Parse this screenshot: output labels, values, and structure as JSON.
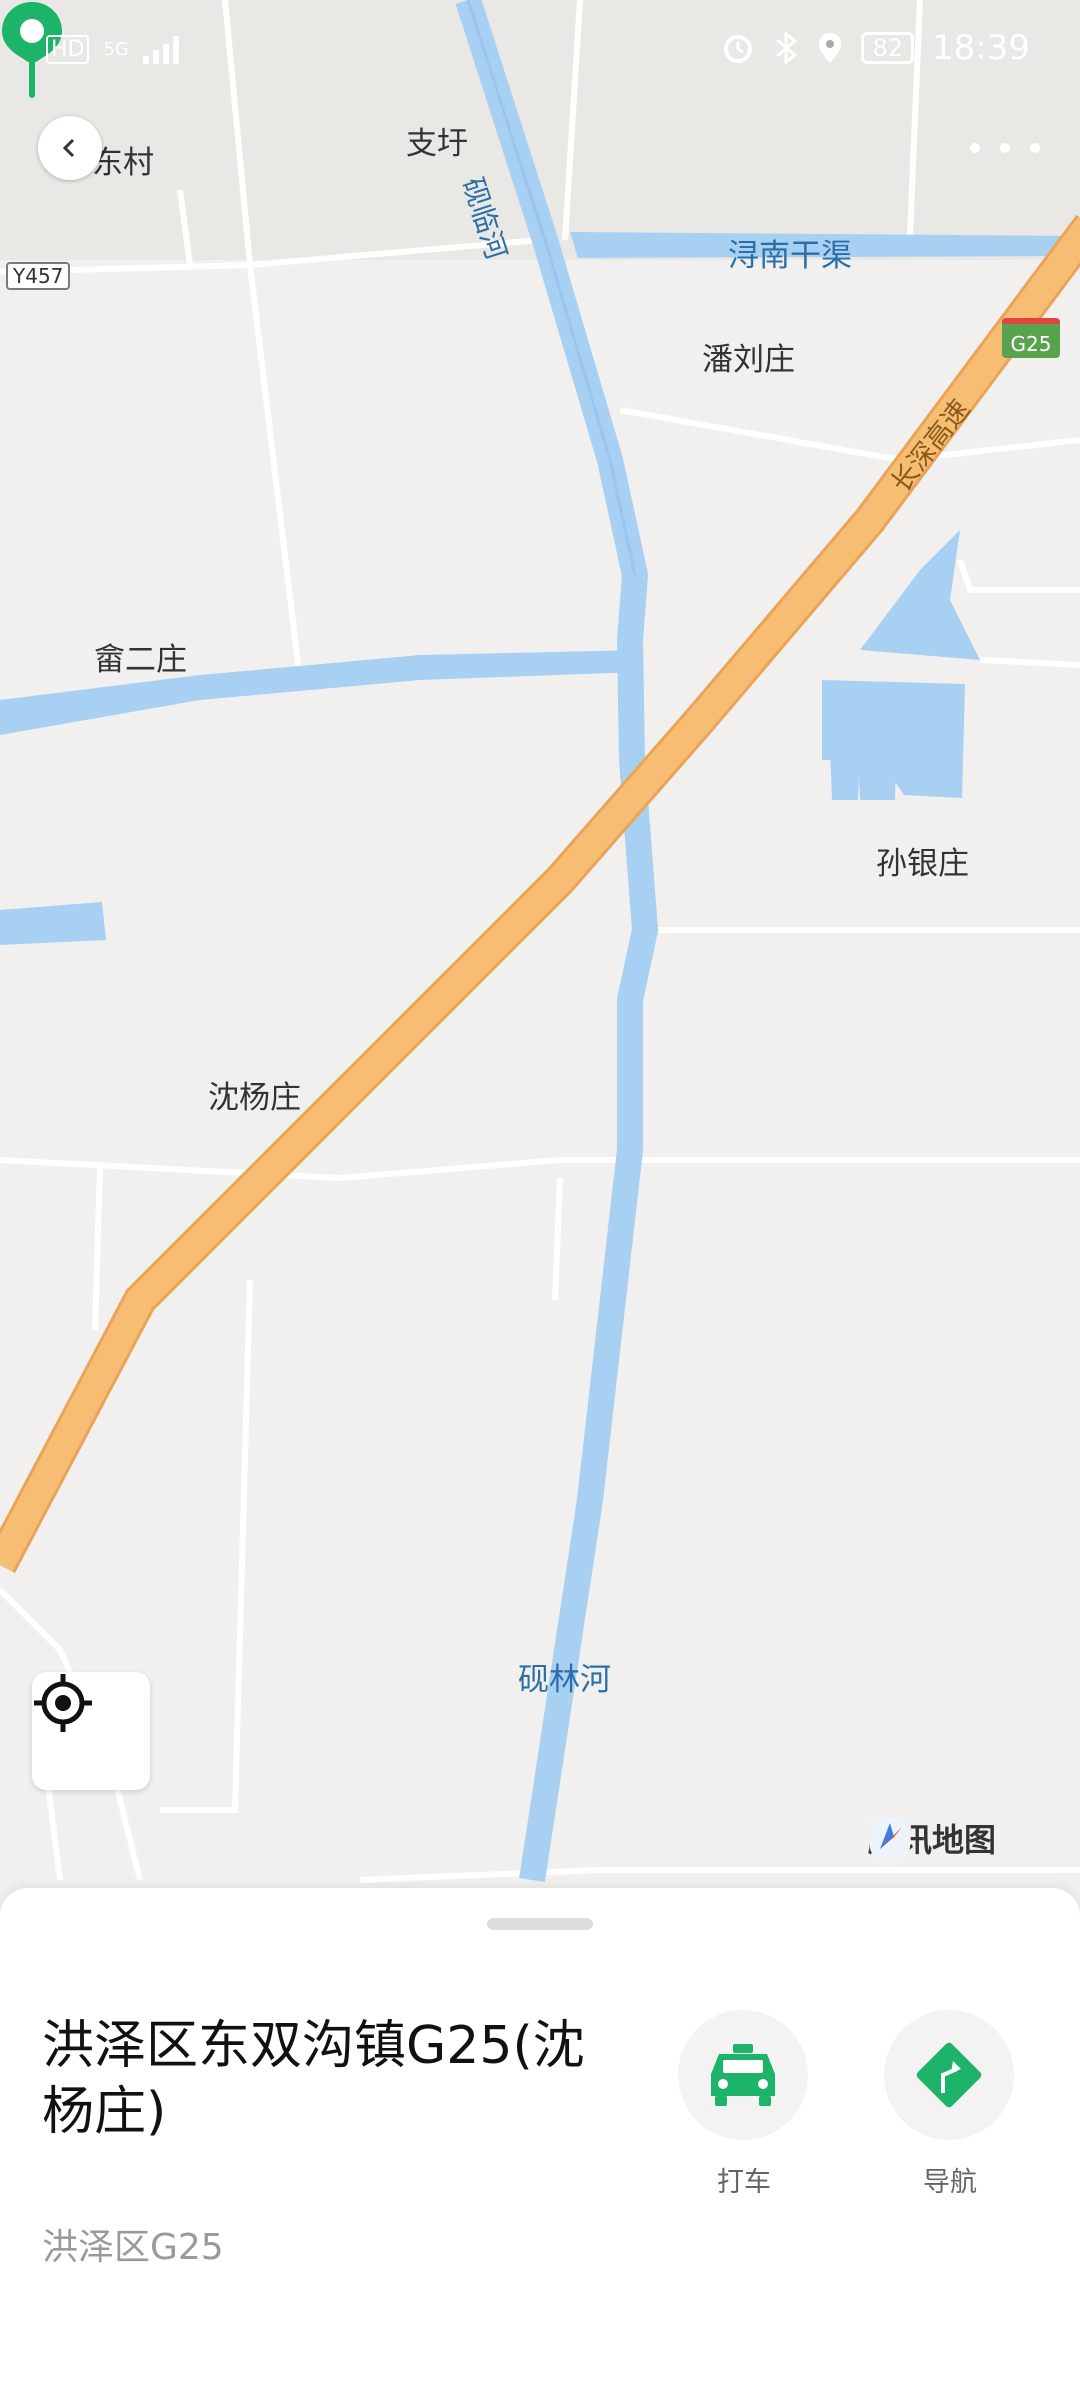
{
  "status_bar": {
    "hd": "HD",
    "network": "5G",
    "battery": "82",
    "time": "18:39"
  },
  "map": {
    "labels": {
      "village_dongcun": "东村",
      "zhiyu": "支圩",
      "river_yanlinhe_top": "砚临河",
      "canal": "浔南干渠",
      "road_y457": "Y457",
      "highway_shield": "G25",
      "panliuzhuang": "潘刘庄",
      "highway_name": "长深高速",
      "sheerzhuang": "畲二庄",
      "sunyinzhuang": "孙银庄",
      "shenyangzhuang": "沈杨庄",
      "river_yanlinhe": "砚林河"
    },
    "provider": "腾讯地图",
    "colors": {
      "water": "#a8d0f3",
      "highway": "#f6bd73",
      "pin": "#1db46a"
    }
  },
  "place": {
    "title": "洪泽区东双沟镇G25(沈杨庄)",
    "address": "洪泽区G25"
  },
  "actions": {
    "taxi_label": "打车",
    "nav_label": "导航"
  }
}
